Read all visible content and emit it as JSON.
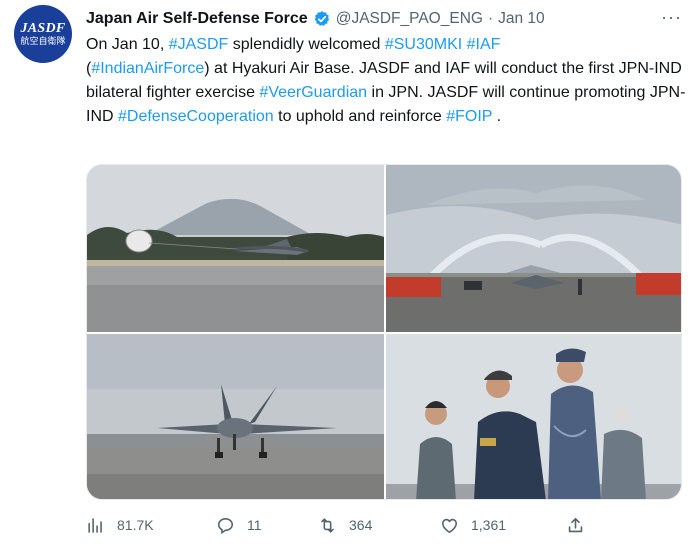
{
  "account": {
    "avatar_line1": "JASDF",
    "avatar_line2": "航空自衛隊",
    "name": "Japan Air Self-Defense Force",
    "handle": "@JASDF_PAO_ENG",
    "separator": "·",
    "date": "Jan 10"
  },
  "more_label": "···",
  "tweet": {
    "t1": "On Jan 10, ",
    "h1": "#JASDF",
    "t2": " splendidly welcomed ",
    "h2": "#SU30MKI",
    "t3": " ",
    "h3": "#IAF",
    "t4": "(",
    "h4": "#IndianAirForce",
    "t5": ") at Hyakuri Air Base. JASDF and IAF will conduct the first JPN-IND bilateral fighter exercise ",
    "h5": "#VeerGuardian",
    "t6": " in JPN. JASDF will continue promoting JPN-IND ",
    "h6": "#DefenseCooperation",
    "t7": " to uphold and reinforce ",
    "h7": "#FOIP",
    "t8": " ."
  },
  "actions": {
    "views": "81.7K",
    "replies": "11",
    "retweets": "364",
    "likes": "1,361"
  },
  "colors": {
    "link": "#1d9bf0",
    "secondary_text": "#536471",
    "verified": "#1d9bf0",
    "avatar_bg": "#1a3f9a"
  },
  "icons": [
    "verified-badge-icon",
    "more-icon",
    "views-icon",
    "reply-icon",
    "retweet-icon",
    "like-icon",
    "share-icon"
  ]
}
